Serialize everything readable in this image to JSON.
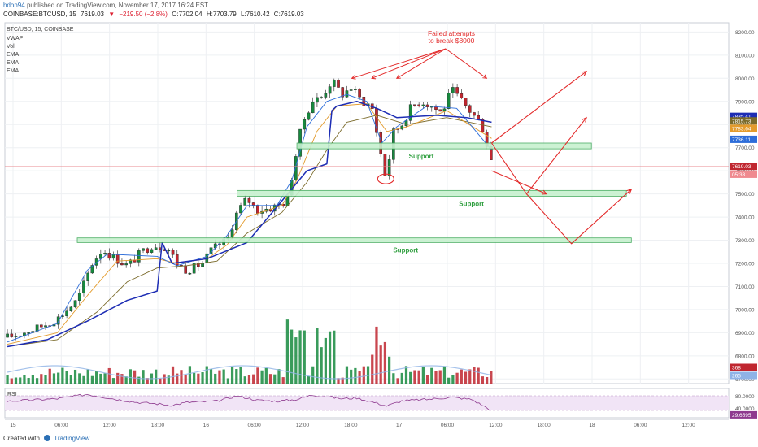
{
  "header": {
    "user": "hdon94",
    "published_text": "published on TradingView.com, November 17, 2017 16:24 EST",
    "symbol": "COINBASE:BTCUSD, 15",
    "price": "7619.03",
    "arrow": "▼",
    "change": "−219.50 (−2.8%)",
    "open": "O:7702.04",
    "high": "H:7703.79",
    "low": "L:7610.42",
    "close": "C:7619.03"
  },
  "legend": {
    "title": "BTC/USD, 15, COINBASE",
    "items": [
      "VWAP",
      "Vol",
      "EMA",
      "EMA",
      "EMA"
    ]
  },
  "footer": {
    "created_with": "Created with",
    "brand": "TradingView"
  },
  "annotations": {
    "failed": [
      "Failed attempts",
      "to break $8000"
    ],
    "support_label": "Support"
  },
  "colors": {
    "bull": "#168a3e",
    "bear": "#c0262f",
    "vwap": "#1d2db4",
    "ema_fast": "#2d6dd9",
    "ema_mid": "#e39b2c",
    "ema_slow": "#7a6a2a",
    "annotation": "#e32b2b",
    "support_fill": "#c7f1cf",
    "support_stroke": "#3aa655",
    "support_text": "#2e9e3e",
    "rsi_line": "#8e3a8f",
    "rsi_band": "#f1e4f6"
  },
  "chart_data": {
    "type": "candlestick",
    "x_tick_labels": [
      "15",
      "06:00",
      "12:00",
      "18:00",
      "16",
      "06:00",
      "12:00",
      "18:00",
      "17",
      "06:00",
      "12:00",
      "18:00",
      "18",
      "06:00",
      "12:00"
    ],
    "y_tick_labels": [
      "8200.00",
      "8100.00",
      "8000.00",
      "7900.00",
      "7800.00",
      "7700.00",
      "7600.00",
      "7500.00",
      "7400.00",
      "7300.00",
      "7200.00",
      "7100.00",
      "7000.00",
      "6900.00",
      "6800.00",
      "6700.00"
    ],
    "ylim": [
      6680,
      8240
    ],
    "price_path": [
      [
        0,
        6880
      ],
      [
        6,
        6920
      ],
      [
        10,
        6960
      ],
      [
        14,
        7040
      ],
      [
        17,
        7200
      ],
      [
        19,
        7260
      ],
      [
        21,
        7230
      ],
      [
        24,
        7190
      ],
      [
        27,
        7250
      ],
      [
        29,
        7280
      ],
      [
        32,
        7270
      ],
      [
        34,
        7200
      ],
      [
        36,
        7170
      ],
      [
        39,
        7200
      ],
      [
        41,
        7260
      ],
      [
        44,
        7300
      ],
      [
        46,
        7420
      ],
      [
        48,
        7480
      ],
      [
        50,
        7430
      ],
      [
        53,
        7440
      ],
      [
        56,
        7470
      ],
      [
        57,
        7580
      ],
      [
        59,
        7800
      ],
      [
        61,
        7900
      ],
      [
        63,
        7920
      ],
      [
        65,
        7990
      ],
      [
        67,
        7930
      ],
      [
        69,
        7960
      ],
      [
        71,
        7900
      ],
      [
        73,
        7880
      ],
      [
        75,
        7650
      ],
      [
        76,
        7550
      ],
      [
        77,
        7760
      ],
      [
        79,
        7800
      ],
      [
        81,
        7880
      ],
      [
        83,
        7900
      ],
      [
        85,
        7880
      ],
      [
        87,
        7850
      ],
      [
        89,
        7950
      ],
      [
        91,
        7900
      ],
      [
        93,
        7850
      ],
      [
        95,
        7800
      ],
      [
        96,
        7720
      ],
      [
        97,
        7640
      ]
    ],
    "vwap_path": [
      [
        0,
        6840
      ],
      [
        8,
        6870
      ],
      [
        16,
        6950
      ],
      [
        24,
        7040
      ],
      [
        30,
        7080
      ],
      [
        31,
        7290
      ],
      [
        33,
        7200
      ],
      [
        40,
        7220
      ],
      [
        48,
        7290
      ],
      [
        55,
        7470
      ],
      [
        60,
        7600
      ],
      [
        64,
        7630
      ],
      [
        65,
        7860
      ],
      [
        66,
        7880
      ],
      [
        70,
        7900
      ],
      [
        74,
        7870
      ],
      [
        78,
        7830
      ],
      [
        86,
        7840
      ],
      [
        92,
        7830
      ],
      [
        97,
        7810
      ]
    ],
    "ema_fast_path": [
      [
        0,
        6860
      ],
      [
        10,
        6940
      ],
      [
        16,
        7170
      ],
      [
        20,
        7240
      ],
      [
        30,
        7230
      ],
      [
        34,
        7190
      ],
      [
        40,
        7230
      ],
      [
        44,
        7320
      ],
      [
        48,
        7450
      ],
      [
        54,
        7450
      ],
      [
        57,
        7560
      ],
      [
        60,
        7790
      ],
      [
        64,
        7900
      ],
      [
        68,
        7930
      ],
      [
        72,
        7900
      ],
      [
        75,
        7720
      ],
      [
        78,
        7790
      ],
      [
        84,
        7880
      ],
      [
        90,
        7870
      ],
      [
        97,
        7690
      ]
    ],
    "ema_mid_path": [
      [
        0,
        6850
      ],
      [
        10,
        6900
      ],
      [
        16,
        7060
      ],
      [
        22,
        7210
      ],
      [
        30,
        7220
      ],
      [
        34,
        7200
      ],
      [
        40,
        7220
      ],
      [
        44,
        7280
      ],
      [
        48,
        7400
      ],
      [
        55,
        7450
      ],
      [
        58,
        7560
      ],
      [
        62,
        7770
      ],
      [
        66,
        7880
      ],
      [
        72,
        7890
      ],
      [
        76,
        7770
      ],
      [
        80,
        7790
      ],
      [
        88,
        7860
      ],
      [
        97,
        7740
      ]
    ],
    "ema_slow_path": [
      [
        0,
        6840
      ],
      [
        10,
        6870
      ],
      [
        18,
        6990
      ],
      [
        24,
        7120
      ],
      [
        30,
        7180
      ],
      [
        36,
        7190
      ],
      [
        42,
        7210
      ],
      [
        48,
        7330
      ],
      [
        55,
        7420
      ],
      [
        60,
        7550
      ],
      [
        64,
        7690
      ],
      [
        68,
        7810
      ],
      [
        74,
        7840
      ],
      [
        80,
        7800
      ],
      [
        88,
        7830
      ],
      [
        97,
        7790
      ]
    ],
    "support_zones": [
      {
        "low": 7695,
        "high": 7720,
        "x_start": 58,
        "x_end": 117,
        "label": "Support"
      },
      {
        "low": 7490,
        "high": 7515,
        "x_start": 46,
        "x_end": 124,
        "label": "Support"
      },
      {
        "low": 7290,
        "high": 7310,
        "x_start": 14,
        "x_end": 125,
        "label": "Support"
      }
    ],
    "projections": [
      [
        [
          97,
          7720
        ],
        [
          116,
          8030
        ]
      ],
      [
        [
          97,
          7720
        ],
        [
          104,
          7500
        ],
        [
          116,
          7830
        ]
      ],
      [
        [
          104,
          7500
        ],
        [
          113,
          7285
        ],
        [
          125,
          7520
        ]
      ],
      [
        [
          97,
          7600
        ],
        [
          108,
          7500
        ]
      ]
    ],
    "failed_attempts_x": [
      69,
      73,
      78,
      96
    ],
    "price_marker_labels": [
      {
        "value": 7835.41,
        "text": "7835.41",
        "color": "#1d2db4"
      },
      {
        "value": 7815.73,
        "text": "7815.73",
        "color": "#7a6a2a"
      },
      {
        "value": 7783.64,
        "text": "7783.64",
        "color": "#e39b2c"
      },
      {
        "value": 7736.11,
        "text": "7736.11",
        "color": "#2d6dd9"
      },
      {
        "value": 7619.03,
        "text": "7619.03",
        "color": "#c0262f"
      },
      {
        "value": 7585.0,
        "text": "05:33",
        "color": "#ef8a8f"
      }
    ],
    "volume_labels": [
      {
        "text": "368",
        "color": "#c0262f"
      },
      {
        "text": "265",
        "color": "#8fb3e6"
      }
    ],
    "rsi": {
      "title": "RSI",
      "tick_labels": [
        "80.0000",
        "40.0000"
      ],
      "value_label": "29.6595",
      "path": [
        [
          0,
          55
        ],
        [
          10,
          62
        ],
        [
          16,
          74
        ],
        [
          22,
          60
        ],
        [
          26,
          52
        ],
        [
          30,
          48
        ],
        [
          33,
          44
        ],
        [
          36,
          52
        ],
        [
          42,
          55
        ],
        [
          46,
          70
        ],
        [
          50,
          58
        ],
        [
          54,
          55
        ],
        [
          58,
          60
        ],
        [
          61,
          72
        ],
        [
          64,
          68
        ],
        [
          67,
          62
        ],
        [
          70,
          64
        ],
        [
          74,
          50
        ],
        [
          76,
          42
        ],
        [
          79,
          56
        ],
        [
          84,
          60
        ],
        [
          89,
          66
        ],
        [
          93,
          60
        ],
        [
          97,
          30
        ]
      ]
    }
  }
}
